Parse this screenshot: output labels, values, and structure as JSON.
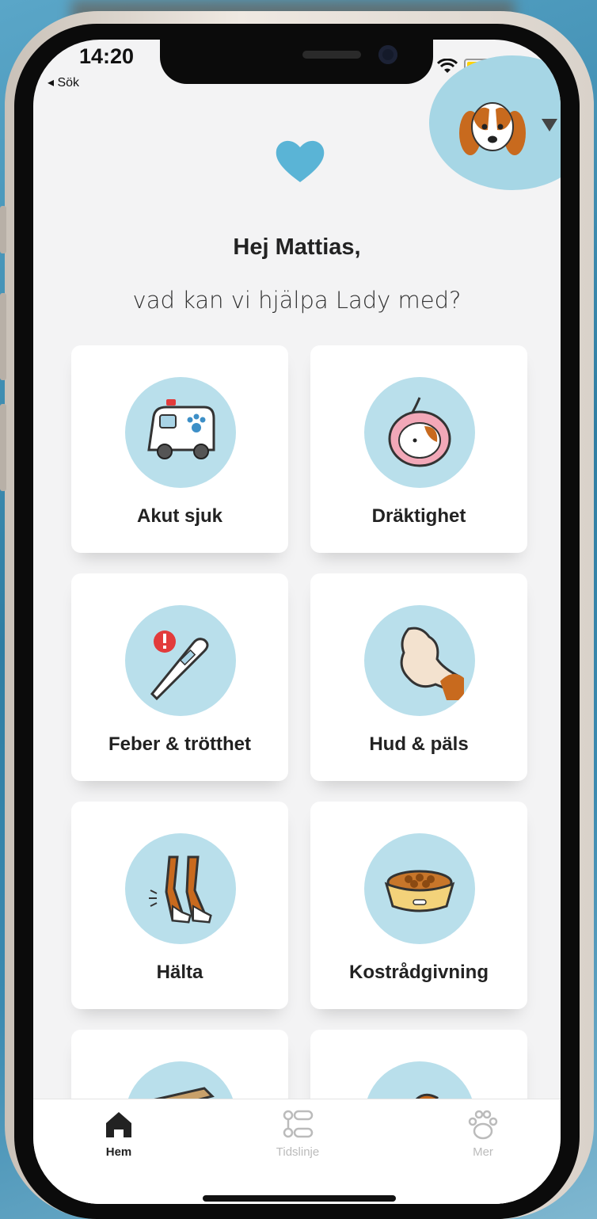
{
  "status_bar": {
    "time": "14:20",
    "back_label": "◂ Sök"
  },
  "header": {
    "greeting": "Hej Mattias,",
    "question": "vad kan vi hjälpa Lady med?"
  },
  "categories": [
    {
      "label": "Akut sjuk",
      "icon": "ambulance-icon"
    },
    {
      "label": "Dräktighet",
      "icon": "pregnancy-icon"
    },
    {
      "label": "Feber & trötthet",
      "icon": "thermometer-icon"
    },
    {
      "label": "Hud & päls",
      "icon": "fur-icon"
    },
    {
      "label": "Hälta",
      "icon": "legs-icon"
    },
    {
      "label": "Kostrådgivning",
      "icon": "food-bowl-icon"
    }
  ],
  "tabs": [
    {
      "label": "Hem",
      "icon": "home-icon",
      "active": true
    },
    {
      "label": "Tidslinje",
      "icon": "timeline-icon",
      "active": false
    },
    {
      "label": "Mer",
      "icon": "paw-icon",
      "active": false
    }
  ],
  "colors": {
    "accent": "#5ab4d6",
    "circle": "#b9dfeb",
    "background": "#f3f3f4"
  }
}
